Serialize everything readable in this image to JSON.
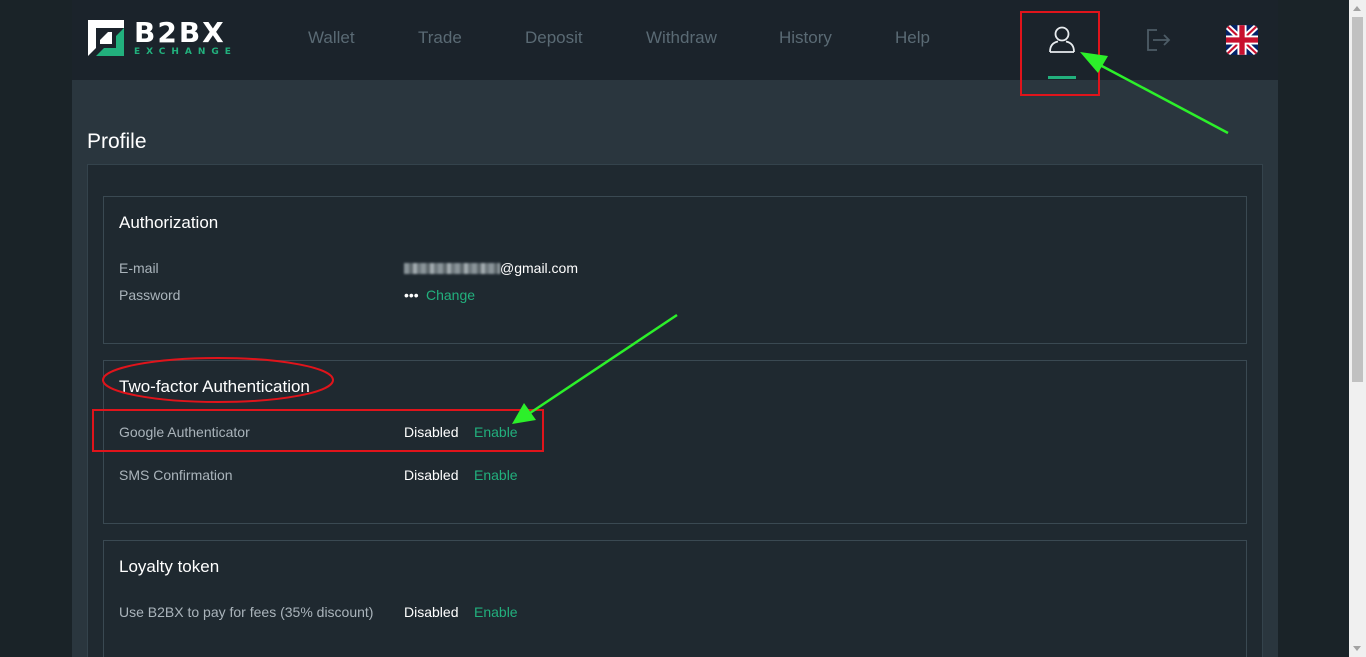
{
  "brand": {
    "name": "B2BX",
    "tagline": "EXCHANGE"
  },
  "nav": {
    "items": [
      {
        "label": "Wallet"
      },
      {
        "label": "Trade"
      },
      {
        "label": "Deposit"
      },
      {
        "label": "Withdraw"
      },
      {
        "label": "History"
      },
      {
        "label": "Help"
      }
    ],
    "icons": [
      "user-icon",
      "logout-icon",
      "uk-flag-icon"
    ]
  },
  "page": {
    "title": "Profile"
  },
  "authorization": {
    "title": "Authorization",
    "email_label": "E-mail",
    "email_suffix": "@gmail.com",
    "password_label": "Password",
    "password_mask": "•••",
    "change_label": "Change"
  },
  "two_factor": {
    "title": "Two-factor Authentication",
    "google_label": "Google Authenticator",
    "google_status": "Disabled",
    "google_action": "Enable",
    "sms_label": "SMS Confirmation",
    "sms_status": "Disabled",
    "sms_action": "Enable"
  },
  "loyalty": {
    "title": "Loyalty token",
    "fee_label": "Use B2BX to pay for fees (35% discount)",
    "fee_status": "Disabled",
    "fee_action": "Enable"
  },
  "colors": {
    "accent": "#22b07d",
    "annotation_red": "#e0141b",
    "annotation_green": "#2cf02a",
    "header_bg": "#1b232b",
    "panel_bg": "#1f2930"
  }
}
